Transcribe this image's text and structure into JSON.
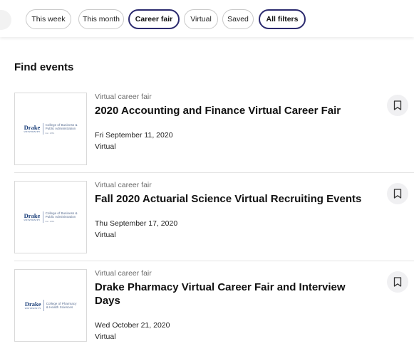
{
  "filters": [
    {
      "label": "This week",
      "active": false
    },
    {
      "label": "This month",
      "active": false
    },
    {
      "label": "Career fair",
      "active": true
    },
    {
      "label": "Virtual",
      "active": false
    },
    {
      "label": "Saved",
      "active": false
    },
    {
      "label": "All filters",
      "active": true
    }
  ],
  "section": {
    "title": "Find events"
  },
  "events": [
    {
      "type": "Virtual career fair",
      "title": "2020 Accounting and Finance Virtual Career Fair",
      "date": "Fri September 11, 2020",
      "location": "Virtual",
      "logo": {
        "mark": "Drake",
        "mark_sub": "UNIVERSITY",
        "lines": [
          "College of Business &",
          "Public Administration"
        ],
        "sub": "Est. 1881"
      }
    },
    {
      "type": "Virtual career fair",
      "title": "Fall 2020 Actuarial Science Virtual Recruiting Events",
      "date": "Thu September 17, 2020",
      "location": "Virtual",
      "logo": {
        "mark": "Drake",
        "mark_sub": "UNIVERSITY",
        "lines": [
          "College of Business &",
          "Public Administration"
        ],
        "sub": "Est. 1881"
      }
    },
    {
      "type": "Virtual career fair",
      "title": "Drake Pharmacy Virtual Career Fair and Interview Days",
      "date": "Wed October 21, 2020",
      "location": "Virtual",
      "logo": {
        "mark": "Drake",
        "mark_sub": "UNIVERSITY",
        "lines": [
          "College of Pharmacy",
          "& Health Sciences"
        ],
        "sub": ""
      }
    }
  ],
  "icons": {
    "bookmark": "bookmark-icon"
  },
  "colors": {
    "accent": "#2b2a6e",
    "logo_blue": "#1b3f7a"
  }
}
